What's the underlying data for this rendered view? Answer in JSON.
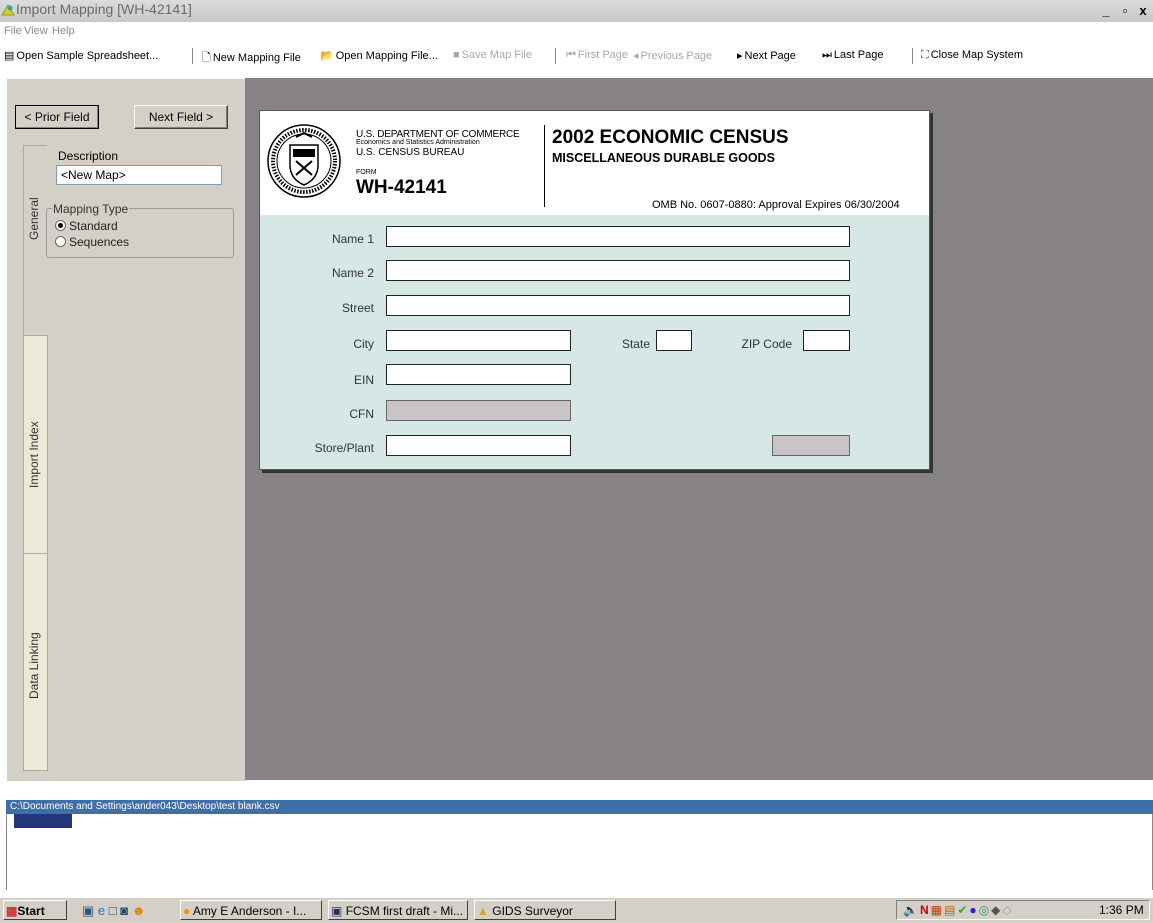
{
  "window": {
    "title": "Import Mapping [WH-42141]",
    "min_glyph": "_",
    "max_glyph": "▫",
    "close_glyph": "x"
  },
  "menu": [
    "File",
    "View",
    "Help"
  ],
  "toolbar": {
    "open_sample": "Open Sample Spreadsheet...",
    "new_mapping": "New Mapping File",
    "open_mapping": "Open Mapping File...",
    "save_map": "Save Map File",
    "first_page": "First Page",
    "previous_page": "Previous Page",
    "next_page": "Next Page",
    "last_page": "Last Page",
    "close_map": "Close Map System"
  },
  "left_panel": {
    "prior_field": "< Prior Field",
    "next_field": "Next Field >",
    "tabs": [
      "General",
      "Import Index",
      "Data Linking"
    ],
    "description_label": "Description",
    "description_value": "<New Map>",
    "mapping_type_label": "Mapping Type",
    "mapping_types": [
      "Standard",
      "Sequences"
    ],
    "selected_mapping_type": "Standard"
  },
  "form": {
    "dept_line1": "U.S. DEPARTMENT OF COMMERCE",
    "dept_line2": "Economics and Statistics Administration",
    "dept_line3": "U.S. CENSUS BUREAU",
    "form_label": "FORM",
    "form_number": "WH-42141",
    "title": "2002 ECONOMIC CENSUS",
    "subtitle": "MISCELLANEOUS DURABLE GOODS",
    "omb": "OMB No. 0607-0880: Approval Expires 06/30/2004",
    "fields": {
      "name1": "Name 1",
      "name2": "Name 2",
      "street": "Street",
      "city": "City",
      "state": "State",
      "zip": "ZIP Code",
      "ein": "EIN",
      "cfn": "CFN",
      "store_plant": "Store/Plant"
    }
  },
  "status": {
    "path": "C:\\Documents and Settings\\ander043\\Desktop\\test blank.csv"
  },
  "taskbar": {
    "start": "Start",
    "tasks": [
      "Amy E Anderson - I...",
      "FCSM first draft - Mi...",
      "GIDS Surveyor"
    ],
    "clock": "1:36 PM"
  },
  "colors": {
    "form_bg": "#d6e8e6",
    "workspace": "#868286",
    "path_bar": "#3f6fa9",
    "panel": "#d4d0c8"
  }
}
